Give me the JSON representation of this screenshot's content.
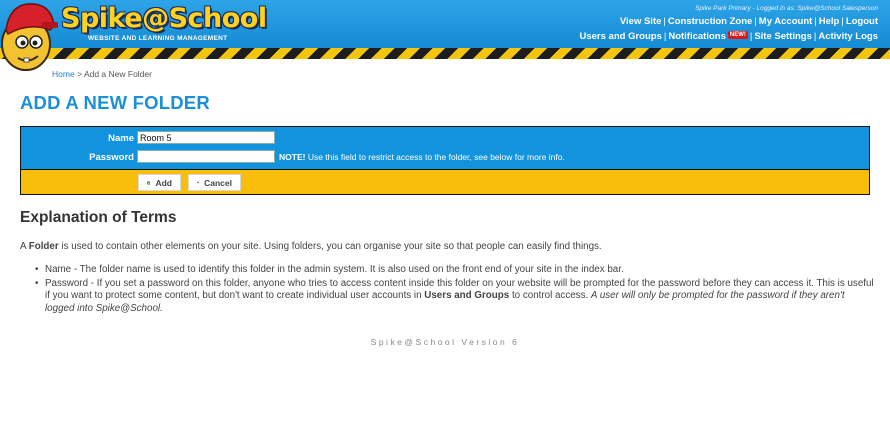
{
  "header": {
    "logo_text": "Spike@School",
    "logo_tagline": "Website and Learning Management",
    "logged_in": "Spike Park Primary - Logged in as: Spike@School Salesperson",
    "nav_row1": [
      "View Site",
      "Construction Zone",
      "My Account",
      "Help",
      "Logout"
    ],
    "nav_row2": [
      "Users and Groups",
      "Notifications",
      "Site Settings",
      "Activity Logs"
    ],
    "new_badge": "NEW!"
  },
  "breadcrumb": {
    "home": "Home",
    "separator": ">",
    "current": "Add a New Folder"
  },
  "page_title": "ADD A NEW FOLDER",
  "form": {
    "name_label": "Name",
    "name_value": "Room 5",
    "password_label": "Password",
    "password_value": "",
    "note_bold": "NOTE!",
    "note_text": "Use this field to restrict access to the folder, see below for more info.",
    "add_label": "Add",
    "cancel_label": "Cancel"
  },
  "explanation": {
    "heading": "Explanation of Terms",
    "intro_prefix": "A",
    "intro_bold": "Folder",
    "intro_rest": "is used to contain other elements on your site. Using folders, you can organise your site so that people can easily find things.",
    "term_name": "Name - The folder name is used to identify this folder in the admin system. It is also used on the front end of your site in the index bar.",
    "term_password_part1": "Password - If you set a password on this folder, anyone who tries to access content inside this folder on your website will be prompted for the password before they can access it. This is useful if you want to protect some content, but don't want to create individual user accounts in",
    "term_password_bold": "Users and Groups",
    "term_password_part2": "to control access.",
    "term_password_italic": "A user will only be prompted for the password if they aren't logged into Spike@School."
  },
  "footer": {
    "version": "Spike@School Version 6"
  },
  "colors": {
    "header_blue": "#1193dd",
    "title_blue": "#1d8fd6",
    "form_yellow": "#f9bd0b",
    "add_green": "#3a9a2a",
    "cancel_red": "#d6181d"
  }
}
